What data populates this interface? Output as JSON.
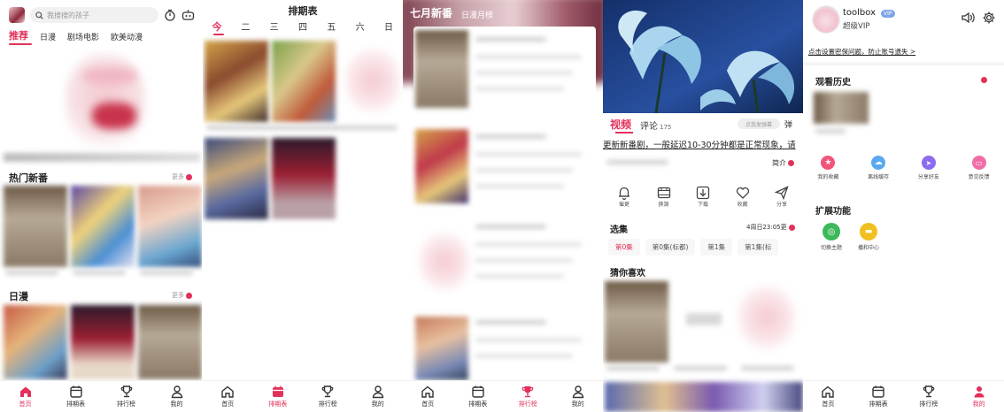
{
  "colors": {
    "accent": "#e2305a",
    "text": "#222222",
    "muted": "#999999",
    "vip": "#7fa5e8"
  },
  "tabbar": {
    "items": [
      {
        "label": "首页",
        "icon": "home-icon"
      },
      {
        "label": "排期表",
        "icon": "calendar-icon"
      },
      {
        "label": "排行榜",
        "icon": "trophy-icon"
      },
      {
        "label": "我的",
        "icon": "user-icon"
      }
    ]
  },
  "home": {
    "search_placeholder": "我搜搜的孩子",
    "nav_tabs": [
      "推荐",
      "日漫",
      "剧场电影",
      "欧美动漫"
    ],
    "section_hot": "热门新番",
    "section_jp": "日漫",
    "more": "更多"
  },
  "schedule": {
    "title": "排期表",
    "days": [
      "今",
      "二",
      "三",
      "四",
      "五",
      "六",
      "日"
    ]
  },
  "ranking": {
    "tabs": [
      "七月新番",
      "日漫月榜"
    ]
  },
  "detail": {
    "tab_video": "视频",
    "tab_comment": "评论",
    "comment_count": "175",
    "danmaku_placeholder": "点我发弹幕",
    "danmaku_icon_label": "弹",
    "notice": "更新新番剧，一般延迟10-30分钟都是正常现象，请",
    "intro": "简介",
    "actions": [
      "催更",
      "换源",
      "下载",
      "收藏",
      "分享"
    ],
    "episodes_label": "选集",
    "update_time": "4周日23:05更",
    "episodes": [
      "第0集",
      "第0集(标都)",
      "第1集",
      "第1集(标"
    ],
    "guess_label": "猜你喜欢"
  },
  "profile": {
    "username": "toolbox",
    "vip_badge": "VIP",
    "vip_text": "超级VIP",
    "settings_notice": "点击设置密保问题，防止账号遗失 >",
    "history_title": "观看历史",
    "quick": [
      {
        "label": "我的收藏",
        "color": "#f2557a"
      },
      {
        "label": "离线缓存",
        "color": "#5aa9f0"
      },
      {
        "label": "分享好友",
        "color": "#8b6cf0"
      },
      {
        "label": "意见反馈",
        "color": "#f06ea8"
      }
    ],
    "ext_title": "扩展功能",
    "ext": [
      {
        "label": "切换主题",
        "color": "#3cb95a"
      },
      {
        "label": "播和中心",
        "color": "#f0c020"
      }
    ]
  }
}
